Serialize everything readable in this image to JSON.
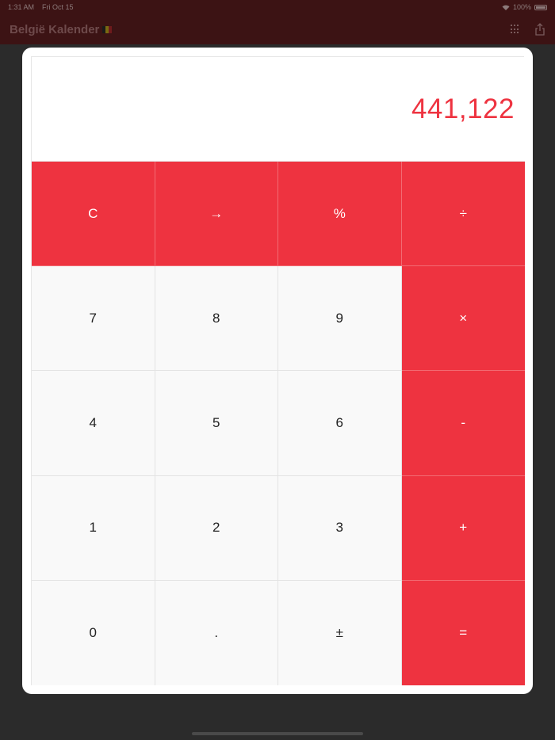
{
  "status_bar": {
    "time": "1:31 AM",
    "date": "Fri Oct 15",
    "battery": "100%"
  },
  "nav": {
    "title": "België Kalender"
  },
  "calculator": {
    "display": "441,122",
    "keys": [
      {
        "label": "C",
        "accent": true
      },
      {
        "label": "→",
        "accent": true
      },
      {
        "label": "%",
        "accent": true
      },
      {
        "label": "÷",
        "accent": true
      },
      {
        "label": "7",
        "accent": false
      },
      {
        "label": "8",
        "accent": false
      },
      {
        "label": "9",
        "accent": false
      },
      {
        "label": "×",
        "accent": true
      },
      {
        "label": "4",
        "accent": false
      },
      {
        "label": "5",
        "accent": false
      },
      {
        "label": "6",
        "accent": false
      },
      {
        "label": "-",
        "accent": true
      },
      {
        "label": "1",
        "accent": false
      },
      {
        "label": "2",
        "accent": false
      },
      {
        "label": "3",
        "accent": false
      },
      {
        "label": "+",
        "accent": true
      },
      {
        "label": "0",
        "accent": false
      },
      {
        "label": ".",
        "accent": false
      },
      {
        "label": "±",
        "accent": false
      },
      {
        "label": "=",
        "accent": true
      }
    ]
  },
  "colors": {
    "accent": "#ee3340",
    "key_bg": "#f9f9f9"
  }
}
